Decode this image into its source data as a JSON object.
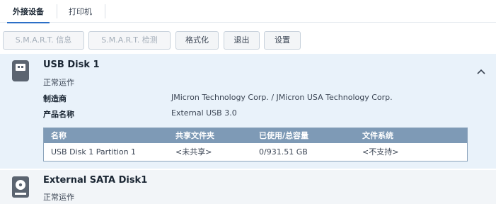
{
  "tabs": [
    {
      "label": "外接设备",
      "active": true
    },
    {
      "label": "打印机",
      "active": false
    }
  ],
  "toolbar": {
    "smart_info": "S.M.A.R.T. 信息",
    "smart_test": "S.M.A.R.T. 检测",
    "format": "格式化",
    "eject": "退出",
    "settings": "设置"
  },
  "devices": [
    {
      "name": "USB Disk 1",
      "status": "正常运作",
      "expanded": true,
      "icon": "usb-drive-icon",
      "fields": [
        {
          "label": "制造商",
          "value": "JMicron Technology Corp. / JMicron USA Technology Corp."
        },
        {
          "label": "产品名称",
          "value": "External USB 3.0"
        }
      ],
      "partitions": {
        "columns": [
          "名称",
          "共享文件夹",
          "已使用/总容量",
          "文件系统"
        ],
        "rows": [
          [
            "USB Disk 1 Partition 1",
            "<未共享>",
            "0/931.51 GB",
            "<不支持>"
          ]
        ]
      }
    },
    {
      "name": "External SATA Disk1",
      "status": "正常运作",
      "expanded": false,
      "icon": "hard-disk-icon"
    }
  ],
  "colors": {
    "accent": "#2b6fc7",
    "selected_panel": "#e9f2fa",
    "table_header": "#7e9ab6"
  }
}
